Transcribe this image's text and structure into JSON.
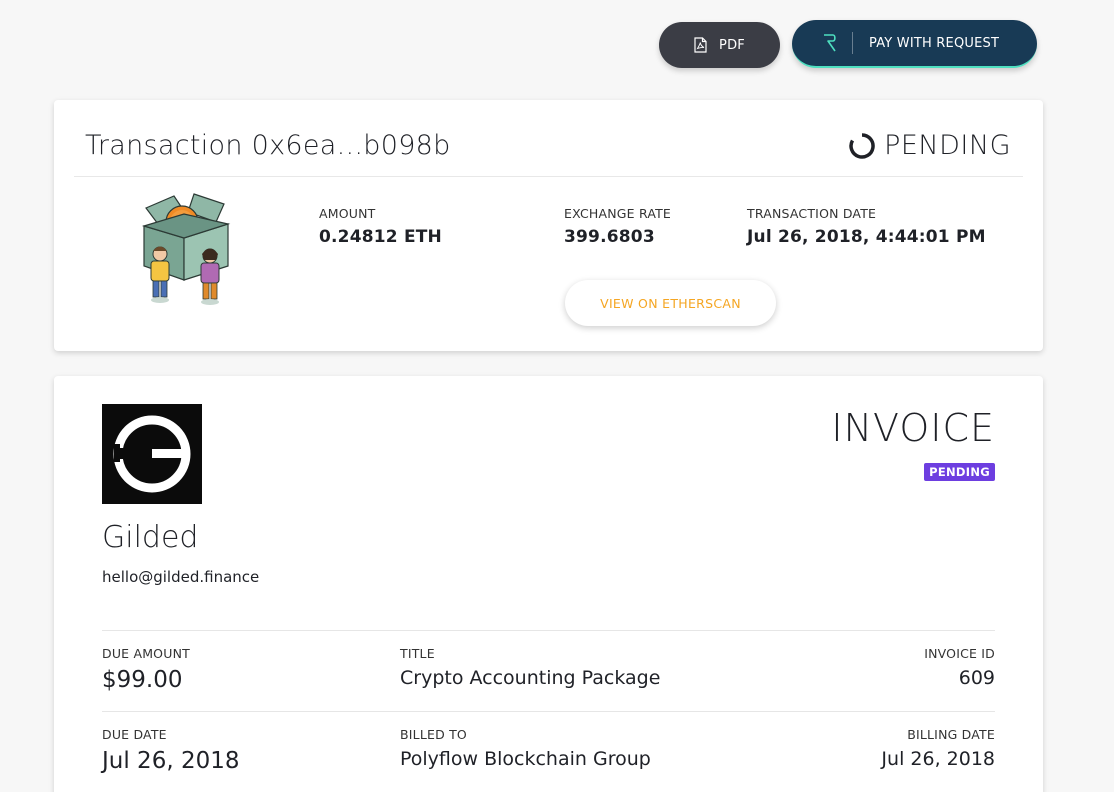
{
  "toolbar": {
    "pdf_label": "PDF",
    "pay_label": "PAY WITH REQUEST",
    "pay_accent": "#4ee0c0"
  },
  "transaction": {
    "title": "Transaction 0x6ea...b098b",
    "status": "PENDING",
    "status_icon": "loading-spinner-icon",
    "amount_label": "AMOUNT",
    "amount_value": "0.24812 ETH",
    "rate_label": "EXCHANGE RATE",
    "rate_value": "399.6803",
    "date_label": "TRANSACTION DATE",
    "date_value": "Jul 26, 2018, 4:44:01 PM",
    "etherscan_label": "VIEW ON ETHERSCAN",
    "etherscan_color": "#f5a623"
  },
  "invoice": {
    "heading": "INVOICE",
    "badge": "PENDING",
    "badge_color": "#6d3ee0",
    "company_name": "Gilded",
    "company_email": "hello@gilded.finance",
    "due_amount_label": "DUE AMOUNT",
    "due_amount_value": "$99.00",
    "title_label": "TITLE",
    "title_value": "Crypto Accounting Package",
    "invoice_id_label": "INVOICE ID",
    "invoice_id_value": "609",
    "due_date_label": "DUE DATE",
    "due_date_value": "Jul 26, 2018",
    "billed_to_label": "BILLED TO",
    "billed_to_value": "Polyflow Blockchain Group",
    "billing_date_label": "BILLING DATE",
    "billing_date_value": "Jul 26, 2018"
  }
}
